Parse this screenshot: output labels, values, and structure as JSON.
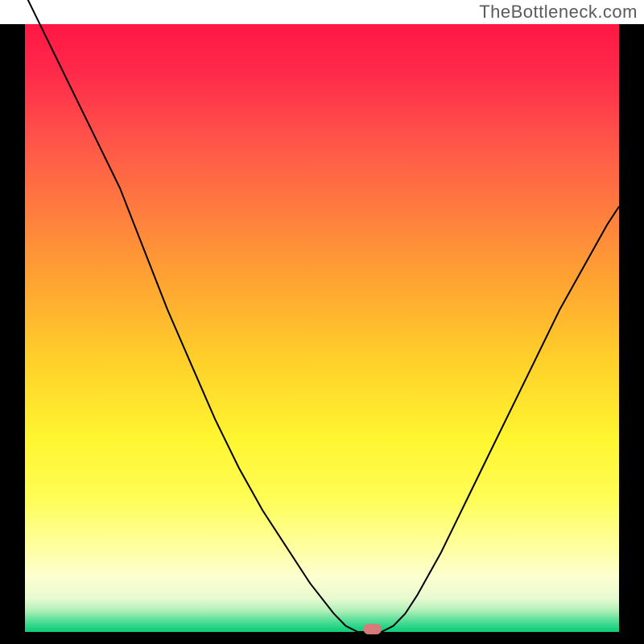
{
  "watermark": "TheBottleneck.com",
  "chart_data": {
    "type": "line",
    "title": "",
    "xlabel": "",
    "ylabel": "",
    "xlim": [
      0,
      100
    ],
    "ylim": [
      0,
      100
    ],
    "x": [
      0,
      4,
      8,
      12,
      16,
      20,
      24,
      28,
      32,
      36,
      40,
      44,
      48,
      52,
      54,
      56,
      58,
      60,
      62,
      64,
      66,
      70,
      74,
      78,
      82,
      86,
      90,
      94,
      98,
      100
    ],
    "values": [
      105,
      97,
      89,
      81,
      73,
      63,
      53,
      44,
      35,
      27,
      20,
      14,
      8,
      3,
      1,
      0,
      0,
      0,
      1,
      3,
      6,
      13,
      21,
      29,
      37,
      45,
      53,
      60,
      67,
      70
    ],
    "marker": {
      "x_start": 57,
      "x_end": 60,
      "color": "#d97a7a"
    },
    "frame": {
      "left_right_bottom_color": "#000000",
      "top_color": null,
      "line_width_outer": 31,
      "line_width_bottom": 15
    },
    "background_gradient_stops": [
      {
        "offset": 0.0,
        "color": "#ff1744"
      },
      {
        "offset": 0.08,
        "color": "#ff2a4a"
      },
      {
        "offset": 0.18,
        "color": "#ff504a"
      },
      {
        "offset": 0.3,
        "color": "#ff7a3f"
      },
      {
        "offset": 0.42,
        "color": "#ffa332"
      },
      {
        "offset": 0.55,
        "color": "#ffcf2a"
      },
      {
        "offset": 0.68,
        "color": "#fff530"
      },
      {
        "offset": 0.78,
        "color": "#fffd55"
      },
      {
        "offset": 0.86,
        "color": "#ffffa0"
      },
      {
        "offset": 0.91,
        "color": "#fcffd0"
      },
      {
        "offset": 0.945,
        "color": "#e8fad0"
      },
      {
        "offset": 0.965,
        "color": "#b0f0b8"
      },
      {
        "offset": 0.98,
        "color": "#5ee09a"
      },
      {
        "offset": 0.995,
        "color": "#1ad080"
      },
      {
        "offset": 1.0,
        "color": "#17cc7a"
      }
    ],
    "line_color": "#000000",
    "line_width": 2
  }
}
